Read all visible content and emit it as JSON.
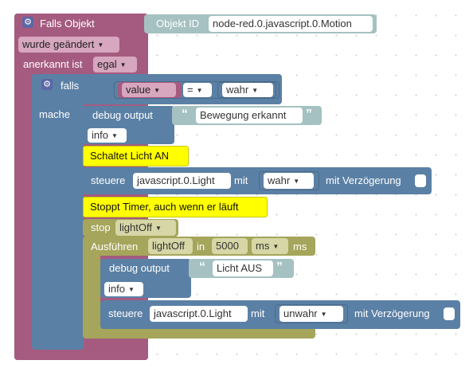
{
  "trigger": {
    "label": "Falls Objekt",
    "object_id_label": "Objekt ID",
    "object_id_value": "node-red.0.javascript.0.Motion",
    "change_value": "wurde geändert",
    "ack_label": "anerkannt ist",
    "ack_value": "egal"
  },
  "if_block": {
    "falls_label": "falls",
    "mache_label": "mache",
    "compare_left": "value",
    "compare_op": "=",
    "compare_right": "wahr"
  },
  "debug1": {
    "label": "debug output",
    "text": "Bewegung erkannt",
    "level": "info"
  },
  "comment1": "Schaltet Licht AN",
  "control1": {
    "label": "steuere",
    "target": "javascript.0.Light",
    "mit_label": "mit",
    "value": "wahr",
    "delay_label": "mit Verzögerung"
  },
  "comment2": "Stoppt Timer, auch wenn er läuft",
  "stop": {
    "label": "stop",
    "timer": "lightOff"
  },
  "timeout": {
    "label": "Ausführen",
    "name": "lightOff",
    "in_label": "in",
    "delay": "5000",
    "unit": "ms",
    "unit_suffix": "ms"
  },
  "debug2": {
    "label": "debug output",
    "text": "Licht AUS",
    "level": "info"
  },
  "control2": {
    "label": "steuere",
    "target": "javascript.0.Light",
    "mit_label": "mit",
    "value": "unwahr",
    "delay_label": "mit Verzögerung"
  },
  "colors": {
    "trigger": "#a55b80",
    "logic": "#5b80a5",
    "timer": "#a5a55b",
    "text_block": "#a5c1c1",
    "comment": "#ffff00",
    "value_block": "#a55b80"
  }
}
